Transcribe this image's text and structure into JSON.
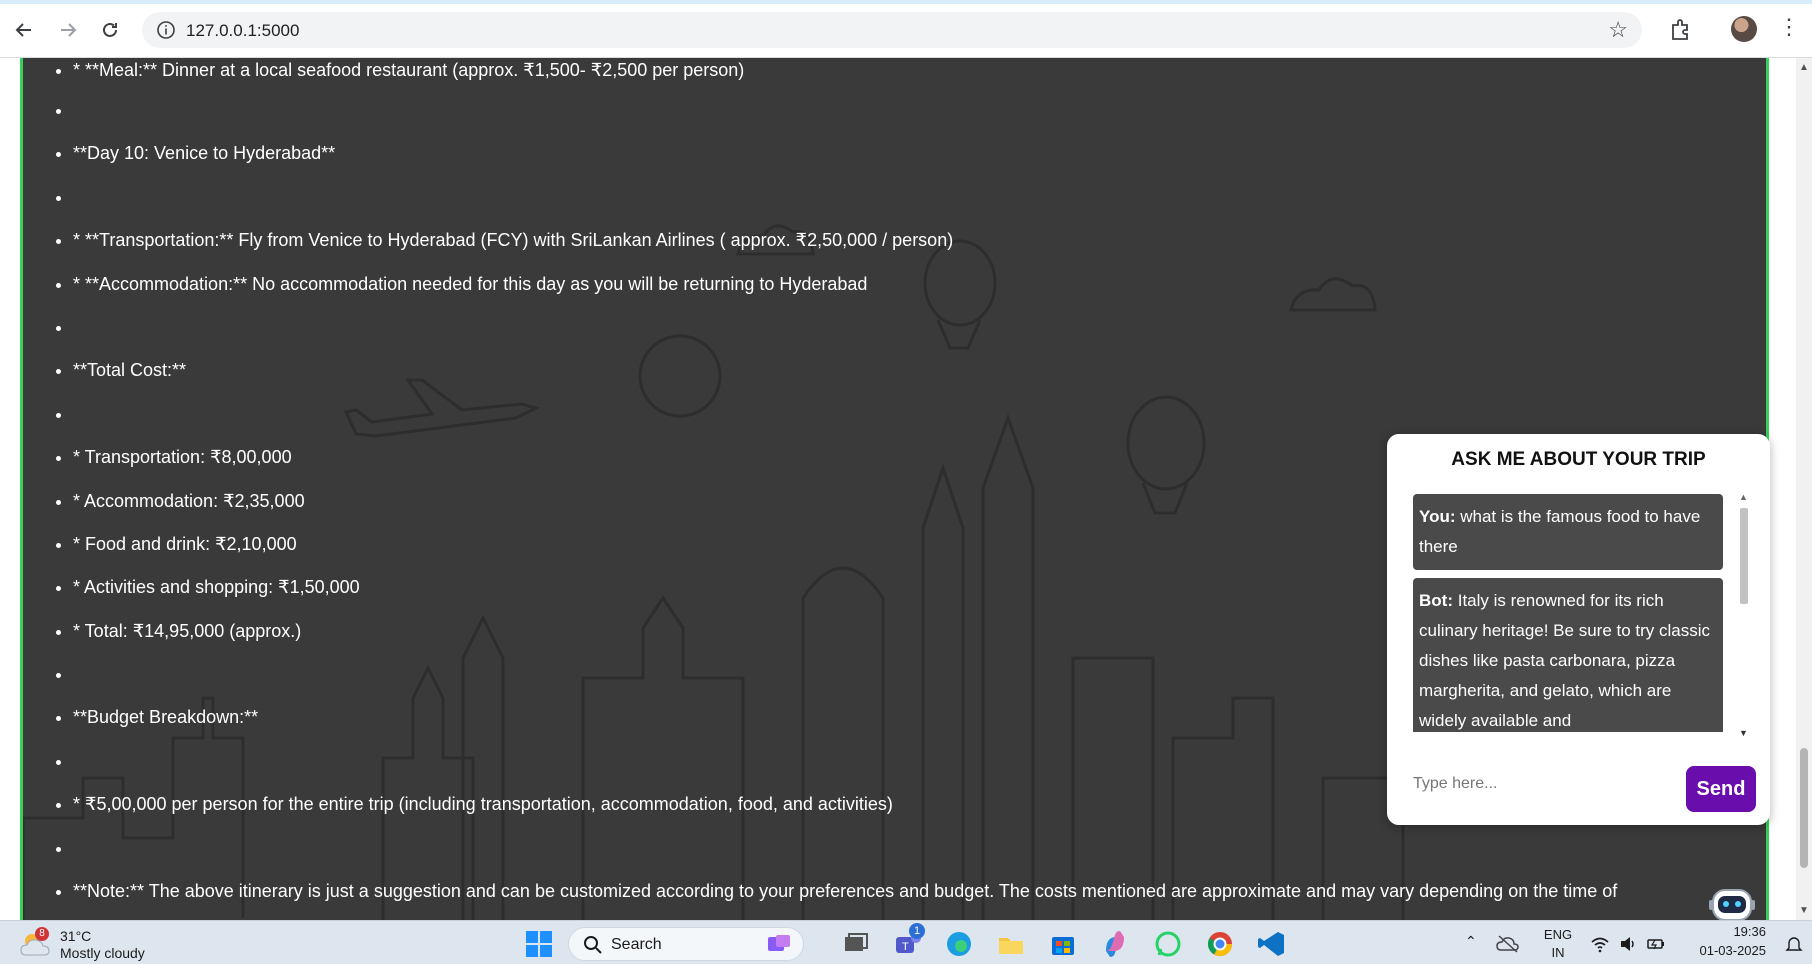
{
  "browser": {
    "url": "127.0.0.1:5000",
    "back_icon": "back-arrow-icon",
    "forward_icon": "forward-arrow-icon",
    "reload_icon": "reload-icon",
    "star_icon": "bookmark-star-icon",
    "menu_icon": "kebab-menu-icon"
  },
  "itinerary": [
    "* **Meal:** Dinner at a local seafood restaurant (approx. ₹1,500- ₹2,500 per person)",
    "",
    "**Day 10: Venice to Hyderabad**",
    "",
    "* **Transportation:** Fly from Venice to Hyderabad (FCY) with SriLankan Airlines ( approx. ₹2,50,000 / person)",
    "* **Accommodation:** No accommodation needed for this day as you will be returning to Hyderabad",
    "",
    "**Total Cost:**",
    "",
    "* Transportation: ₹8,00,000",
    "* Accommodation: ₹2,35,000",
    "* Food and drink: ₹2,10,000",
    "* Activities and shopping: ₹1,50,000",
    "* Total: ₹14,95,000 (approx.)",
    "",
    "**Budget Breakdown:**",
    "",
    "* ₹5,00,000 per person for the entire trip (including transportation, accommodation, food, and activities)",
    "",
    "**Note:** The above itinerary is just a suggestion and can be customized according to your preferences and budget. The costs mentioned are approximate and may vary depending on the time of"
  ],
  "chat": {
    "title": "ASK ME ABOUT YOUR TRIP",
    "messages": [
      {
        "sender": "You:",
        "text": "what is the famous food to have there"
      },
      {
        "sender": "Bot:",
        "text": "Italy is renowned for its rich culinary heritage! Be sure to try classic dishes like pasta carbonara, pizza margherita, and gelato, which are widely available and"
      }
    ],
    "input_placeholder": "Type here...",
    "send_label": "Send"
  },
  "taskbar": {
    "weather_badge": "8",
    "temperature": "31°C",
    "condition": "Mostly cloudy",
    "search_label": "Search",
    "teams_badge": "1",
    "language_top": "ENG",
    "language_bottom": "IN",
    "time": "19:36",
    "date": "01-03-2025"
  },
  "colors": {
    "panel_bg": "#3a3a3a",
    "panel_border": "#35d15a",
    "send_button": "#6a0dad",
    "taskbar_bg": "#dde6ef"
  }
}
